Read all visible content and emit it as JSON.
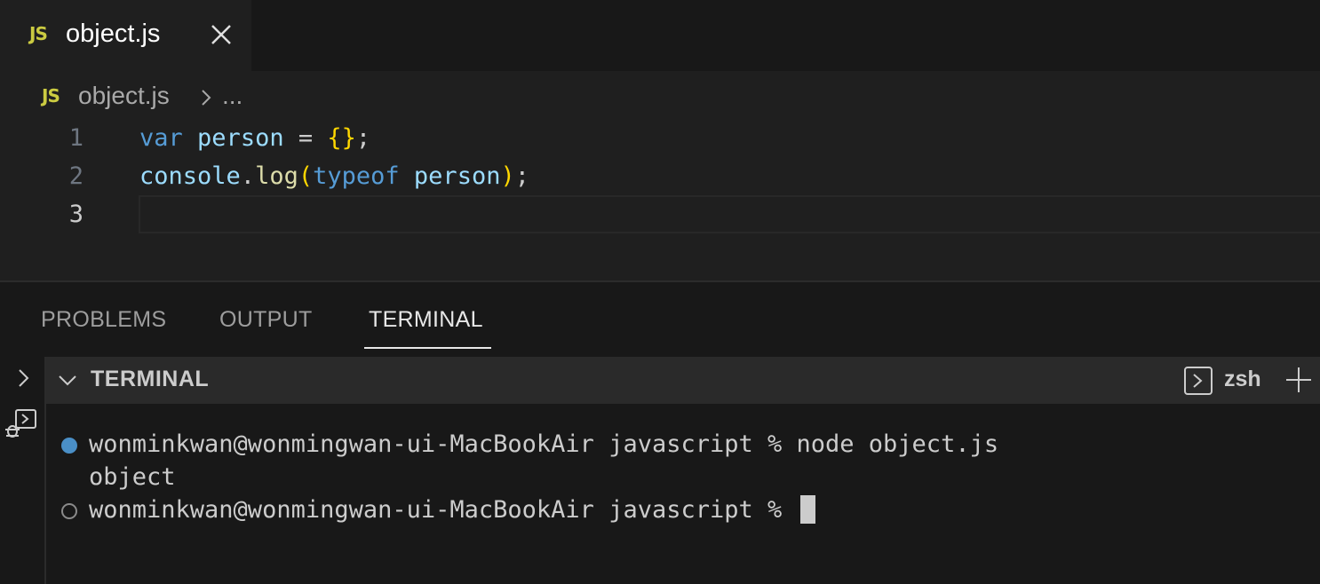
{
  "tab": {
    "badge": "JS",
    "label": "object.js",
    "close_icon": "close-icon"
  },
  "breadcrumb": {
    "badge": "JS",
    "file": "object.js",
    "separator_icon": "chevron-right-icon",
    "ellipsis": "..."
  },
  "editor": {
    "lines": [
      {
        "number": "1",
        "tokens": [
          {
            "text": "var",
            "cls": "kw"
          },
          {
            "text": " ",
            "cls": "punct"
          },
          {
            "text": "person",
            "cls": "var"
          },
          {
            "text": " = ",
            "cls": "punct"
          },
          {
            "text": "{}",
            "cls": "brace"
          },
          {
            "text": ";",
            "cls": "punct"
          }
        ]
      },
      {
        "number": "2",
        "tokens": [
          {
            "text": "console",
            "cls": "var"
          },
          {
            "text": ".",
            "cls": "punct"
          },
          {
            "text": "log",
            "cls": "fn"
          },
          {
            "text": "(",
            "cls": "brace"
          },
          {
            "text": "typeof",
            "cls": "kw"
          },
          {
            "text": " ",
            "cls": "punct"
          },
          {
            "text": "person",
            "cls": "var"
          },
          {
            "text": ")",
            "cls": "brace"
          },
          {
            "text": ";",
            "cls": "punct"
          }
        ]
      },
      {
        "number": "3",
        "tokens": []
      }
    ],
    "active_line": "3"
  },
  "panel": {
    "tabs": [
      {
        "label": "PROBLEMS",
        "active": false
      },
      {
        "label": "OUTPUT",
        "active": false
      },
      {
        "label": "TERMINAL",
        "active": true
      }
    ],
    "terminal_header": {
      "title": "TERMINAL",
      "shell": "zsh",
      "shell_icon": "terminal-icon",
      "add_icon": "plus-icon"
    },
    "terminal_lines": [
      {
        "status": "success",
        "text": "wonminkwan@wonmingwan-ui-MacBookAir javascript % node object.js"
      },
      {
        "status": "none",
        "text": "object"
      },
      {
        "status": "pending",
        "text": "wonminkwan@wonmingwan-ui-MacBookAir javascript % "
      }
    ]
  },
  "colors": {
    "js_badge": "#cbcb41",
    "keyword": "#569cd6",
    "variable": "#9cdcfe",
    "function": "#dcdcaa",
    "bracket": "#ffd700",
    "success_dot": "#4a8fc7"
  }
}
